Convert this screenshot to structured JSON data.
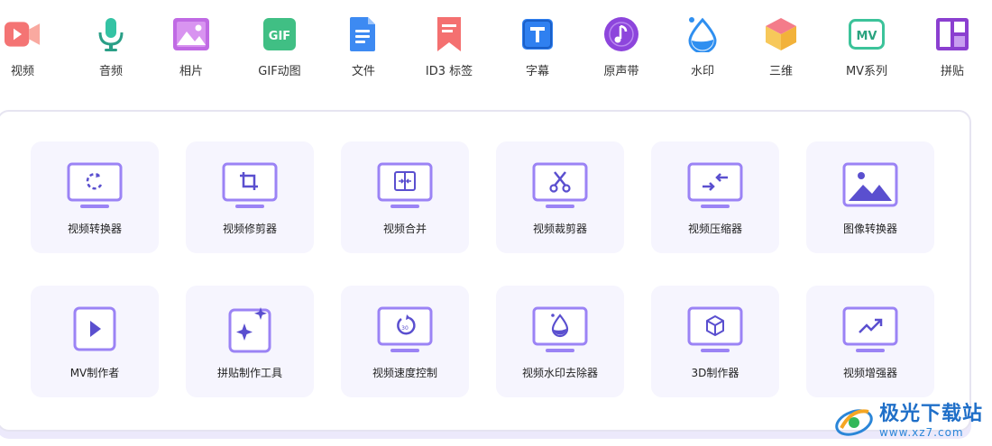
{
  "nav": {
    "items": [
      {
        "label": "视频",
        "icon": "video-icon",
        "color": "#f26a6a"
      },
      {
        "label": "音频",
        "icon": "microphone-icon",
        "color": "#2db59a"
      },
      {
        "label": "相片",
        "icon": "photo-icon",
        "color": "#b45ad8"
      },
      {
        "label": "GIF动图",
        "icon": "gif-icon",
        "color": "#3cb87a"
      },
      {
        "label": "文件",
        "icon": "document-icon",
        "color": "#3a86f0"
      },
      {
        "label": "ID3 标签",
        "icon": "bookmark-icon",
        "color": "#f0605a"
      },
      {
        "label": "字幕",
        "icon": "subtitle-icon",
        "color": "#2f7ff0"
      },
      {
        "label": "原声带",
        "icon": "soundtrack-icon",
        "color": "#8a3fd8"
      },
      {
        "label": "水印",
        "icon": "water-drop-icon",
        "color": "#2f8ff0"
      },
      {
        "label": "三维",
        "icon": "cube-icon",
        "color": "#f5b93a"
      },
      {
        "label": "MV系列",
        "icon": "mv-icon",
        "color": "#3cc39a"
      },
      {
        "label": "拼贴",
        "icon": "collage-icon",
        "color": "#8b3fd0"
      }
    ]
  },
  "tools": {
    "row1": [
      {
        "label": "视频转换器",
        "icon": "convert-icon"
      },
      {
        "label": "视频修剪器",
        "icon": "trim-icon"
      },
      {
        "label": "视频合并",
        "icon": "merge-icon"
      },
      {
        "label": "视频裁剪器",
        "icon": "scissors-icon"
      },
      {
        "label": "视频压缩器",
        "icon": "compress-icon"
      },
      {
        "label": "图像转换器",
        "icon": "image-icon"
      }
    ],
    "row2": [
      {
        "label": "MV制作者",
        "icon": "play-icon"
      },
      {
        "label": "拼贴制作工具",
        "icon": "sparkle-icon"
      },
      {
        "label": "视频速度控制",
        "icon": "speed-icon"
      },
      {
        "label": "视频水印去除器",
        "icon": "watermark-remove-icon"
      },
      {
        "label": "3D制作器",
        "icon": "cube-3d-icon"
      },
      {
        "label": "视频增强器",
        "icon": "trend-icon"
      }
    ]
  },
  "accent_color": "#9b83f5",
  "card_background": "#f6f5fe",
  "watermark": {
    "title": "极光下载站",
    "url": "www.xz7.com"
  }
}
